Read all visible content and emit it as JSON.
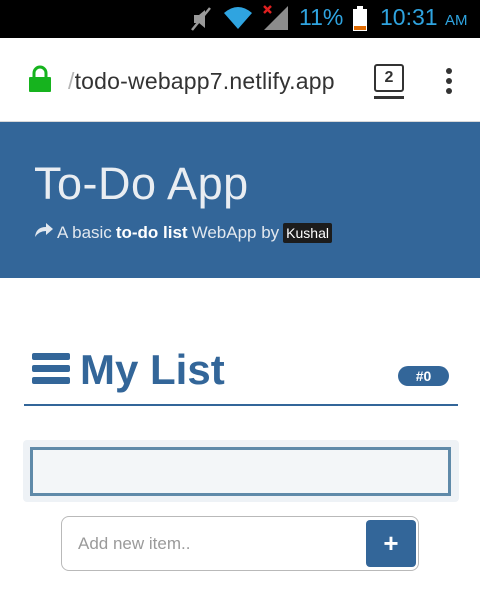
{
  "status_bar": {
    "battery_percent": "11%",
    "time": "10:31",
    "ampm": "AM",
    "icons": [
      "mute-icon",
      "wifi-icon",
      "signal-icon",
      "battery-icon"
    ]
  },
  "browser": {
    "url_prefix": "/",
    "url": "todo-webapp7.netlify.app",
    "tab_count": "2",
    "icons": [
      "lock-icon",
      "menu-icon"
    ]
  },
  "header": {
    "title": "To-Do App",
    "subtitle_prefix": "A basic",
    "subtitle_bold": "to-do list",
    "subtitle_suffix": "WebApp by",
    "author": "Kushal",
    "accent": "#336699"
  },
  "list": {
    "title": "My List",
    "count": "#0",
    "items": []
  },
  "add_item": {
    "placeholder": "Add new item..",
    "button_label": "+"
  }
}
